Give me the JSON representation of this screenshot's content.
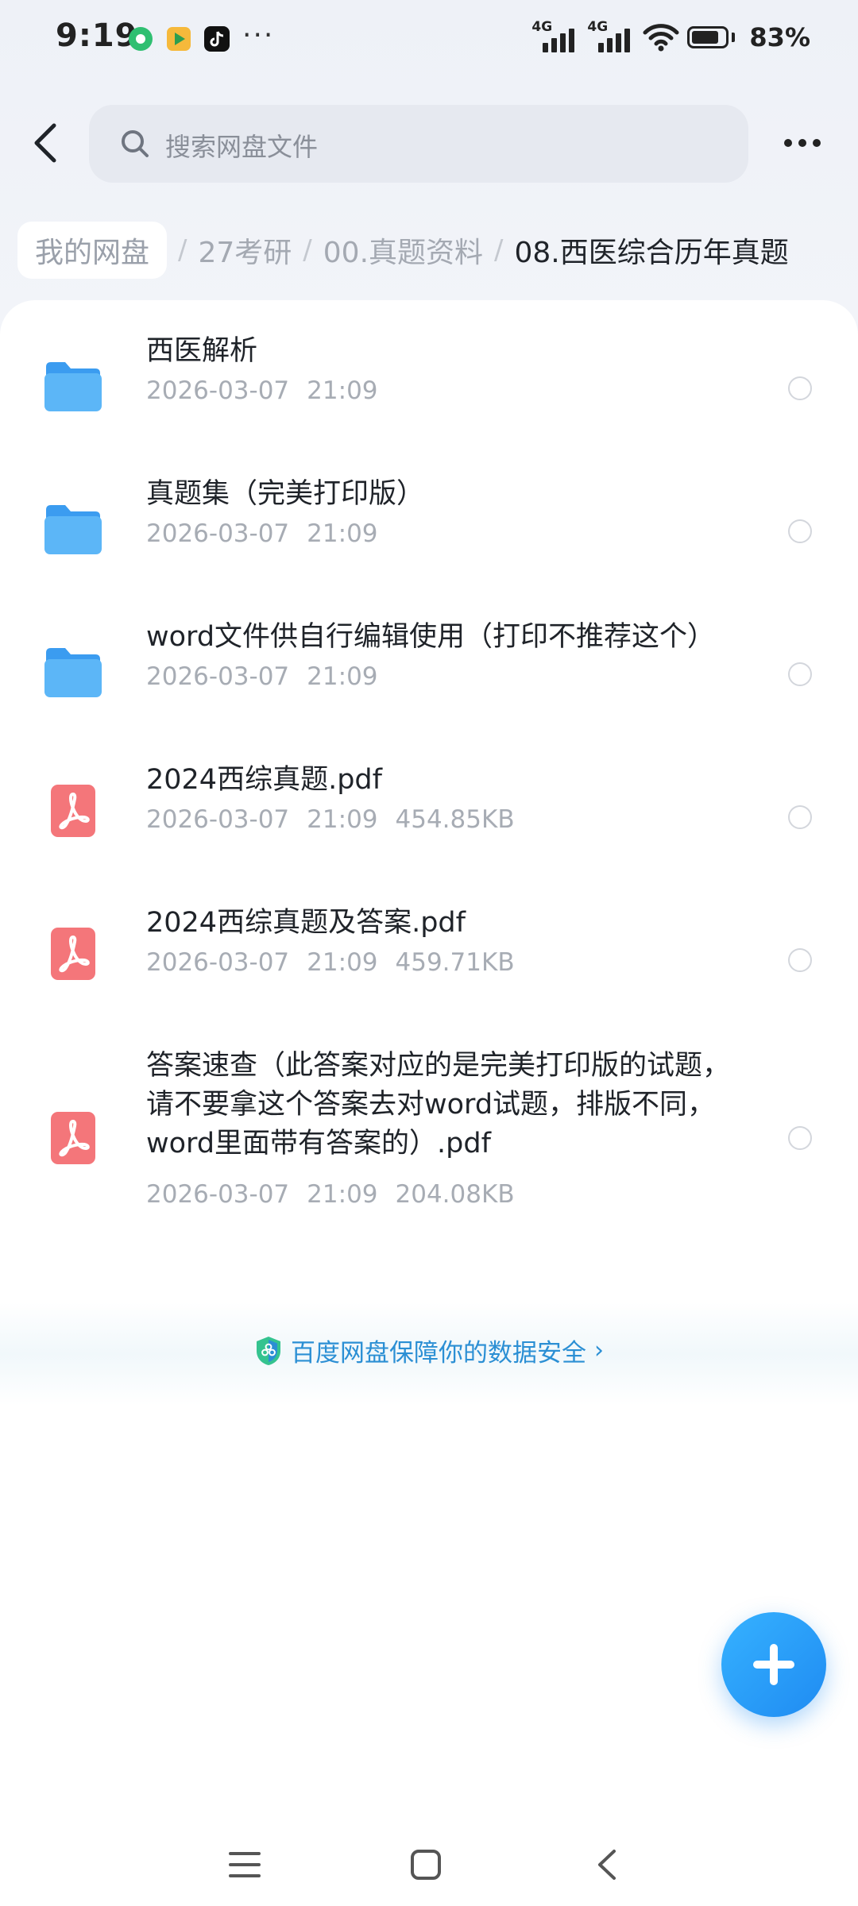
{
  "status_bar": {
    "time": "9:19",
    "net1": "4G",
    "net2": "4G",
    "battery_percent": "83%",
    "battery_level": 0.83,
    "overflow": "···"
  },
  "header": {
    "search_placeholder": "搜索网盘文件"
  },
  "breadcrumb": {
    "root": "我的网盘",
    "path": [
      "27考研",
      "00.真题资料"
    ],
    "current": "08.西医综合历年真题",
    "separator": "/"
  },
  "files": [
    {
      "name": "西医解析",
      "date": "2026-03-07",
      "time": "21:09",
      "size": "",
      "type": "folder"
    },
    {
      "name": "真题集（完美打印版）",
      "date": "2026-03-07",
      "time": "21:09",
      "size": "",
      "type": "folder"
    },
    {
      "name": "word文件供自行编辑使用（打印不推荐这个）",
      "date": "2026-03-07",
      "time": "21:09",
      "size": "",
      "type": "folder"
    },
    {
      "name": "2024西综真题.pdf",
      "date": "2026-03-07",
      "time": "21:09",
      "size": "454.85KB",
      "type": "pdf"
    },
    {
      "name": "2024西综真题及答案.pdf",
      "date": "2026-03-07",
      "time": "21:09",
      "size": "459.71KB",
      "type": "pdf"
    },
    {
      "name": "答案速查（此答案对应的是完美打印版的试题，请不要拿这个答案去对word试题，排版不同，word里面带有答案的）.pdf",
      "date": "2026-03-07",
      "time": "21:09",
      "size": "204.08KB",
      "type": "pdf"
    }
  ],
  "safety": {
    "text": "百度网盘保障你的数据安全",
    "chevron": "›"
  },
  "colors": {
    "accent": "#1f8bf2",
    "folder": "#4aa9f5",
    "pdf": "#f4767a",
    "link": "#2b8fd4"
  },
  "icons": {
    "back": "chevron-left-icon",
    "search": "search-icon",
    "more": "more-horizontal-icon",
    "folder": "folder-icon",
    "pdf": "pdf-icon",
    "shield": "shield-icon",
    "fab": "plus-icon",
    "nav_menu": "menu-icon",
    "nav_home": "square-icon",
    "nav_back": "chevron-left-icon"
  }
}
